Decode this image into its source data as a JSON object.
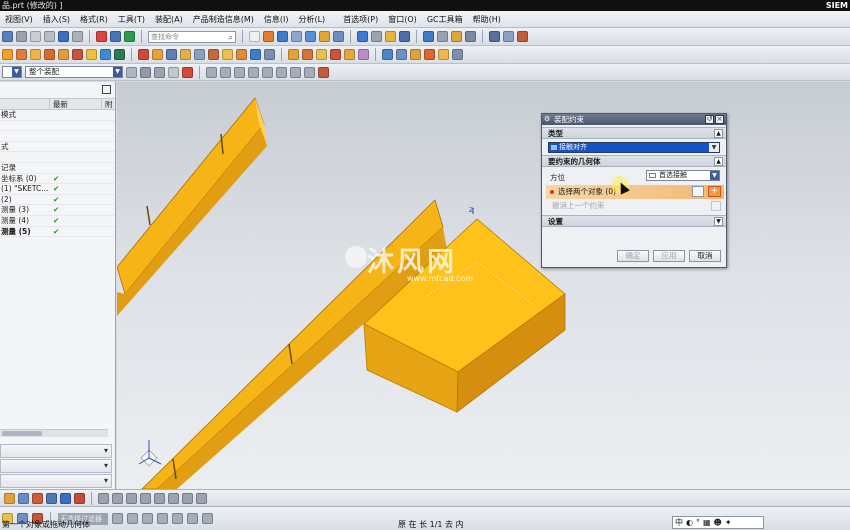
{
  "titlebar": {
    "title": "品.prt  (修改的)  ]",
    "brand": "SIEM"
  },
  "menu": [
    "视图(V)",
    "插入(S)",
    "格式(R)",
    "工具(T)",
    "装配(A)",
    "产品制造信息(M)",
    "信息(I)",
    "分析(L)",
    "首选项(P)",
    "窗口(O)",
    "GC工具箱",
    "帮助(H)"
  ],
  "toolbar": {
    "search_placeholder": "查找命令",
    "assembly_scope": "整个装配"
  },
  "sidebar": {
    "columns": [
      "",
      "最新",
      "附"
    ],
    "rows": [
      {
        "name": "模式",
        "status": ""
      },
      {
        "name": "",
        "status": ""
      },
      {
        "name": "",
        "status": ""
      },
      {
        "name": "式",
        "status": ""
      },
      {
        "name": "",
        "status": ""
      },
      {
        "name": "记录",
        "status": ""
      },
      {
        "name": "坐标系 (0)",
        "status": "✔"
      },
      {
        "name": "(1) \"SKETC...",
        "status": "✔"
      },
      {
        "name": "(2)",
        "status": "✔"
      },
      {
        "name": "测量 (3)",
        "status": "✔"
      },
      {
        "name": "测量 (4)",
        "status": "✔"
      },
      {
        "name": "测量 (5)",
        "status": "✔",
        "bold": true
      }
    ]
  },
  "dialog": {
    "title": "装配约束",
    "type_section": "类型",
    "type_value": "接触对齐",
    "geom_section": "要约束的几何体",
    "orient_label": "方位",
    "orient_value": "首选接触",
    "select_label": "选择两个对象 (0)",
    "undo_label": "撤消上一个约束",
    "settings_section": "设置",
    "ok": "确定",
    "apply": "应用",
    "cancel": "取消"
  },
  "watermark": {
    "cn": "沐风网",
    "en": "www.mfcad.com"
  },
  "selection_filter": "无选择过滤器",
  "status": {
    "prompt": "第一个对象或拖动几何体",
    "right": "原 在 长 1/1 去 内"
  },
  "ime": "中"
}
